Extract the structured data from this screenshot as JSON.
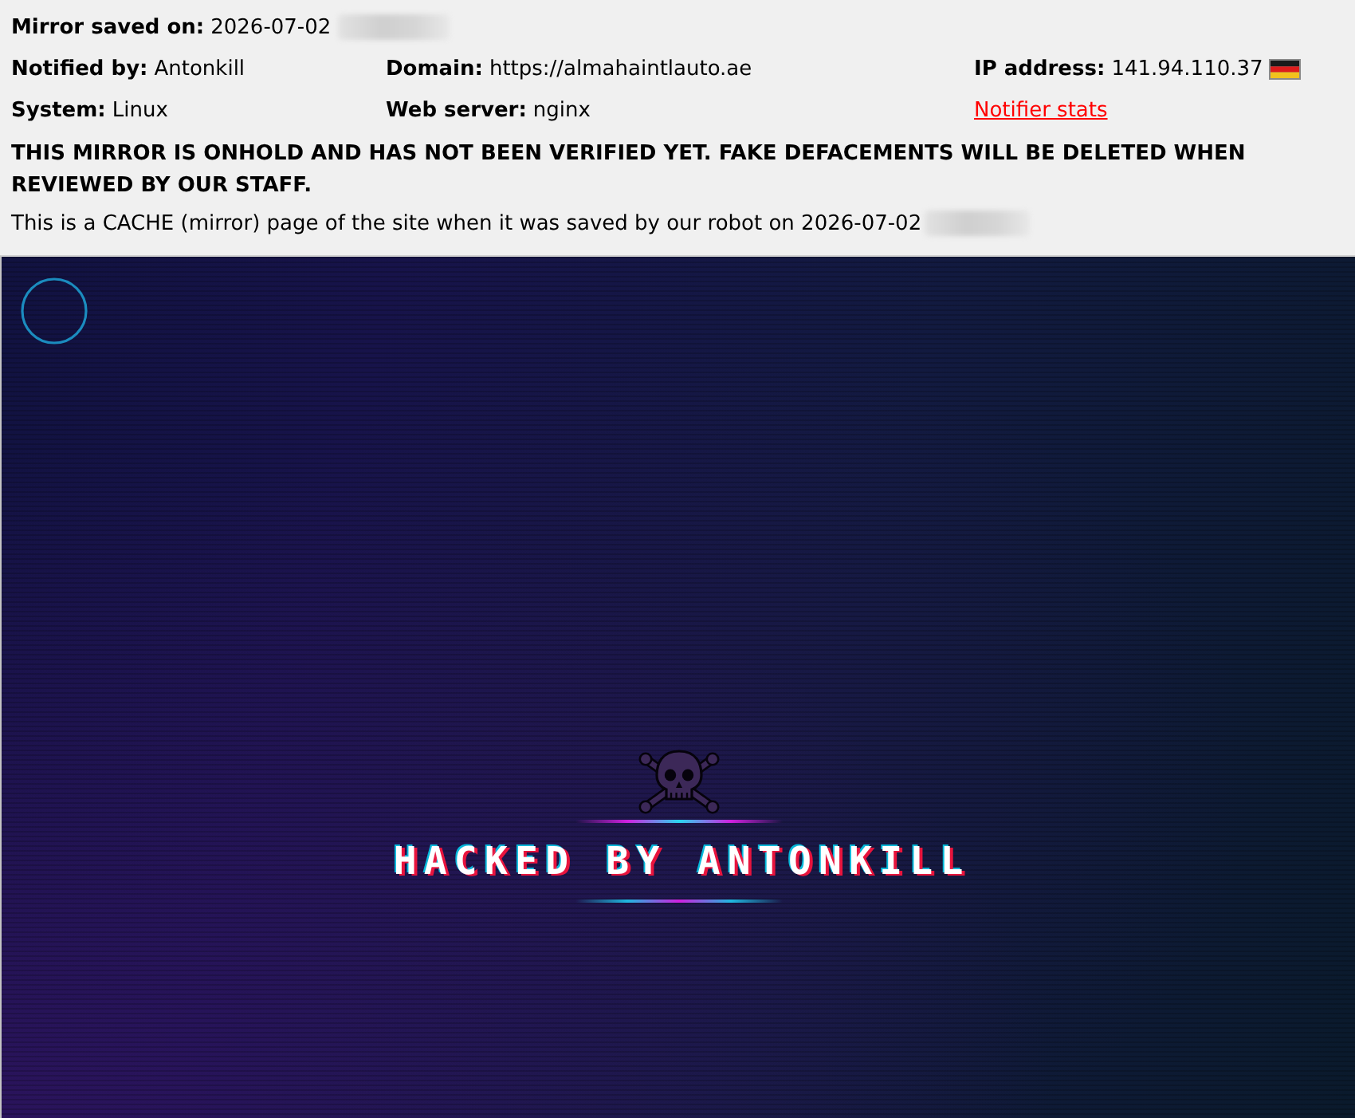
{
  "header": {
    "saved": {
      "label": "Mirror saved on:",
      "value": "2026-07-02",
      "blurred": true
    },
    "fields": [
      {
        "kind": "field",
        "label": "Notified by:",
        "value": "Antonkill"
      },
      {
        "kind": "field",
        "label": "Domain:",
        "value": "https://almahaintlauto.ae"
      },
      {
        "kind": "field_flag",
        "label": "IP address:",
        "value": "141.94.110.37"
      },
      {
        "kind": "field",
        "label": "System:",
        "value": "Linux"
      },
      {
        "kind": "field",
        "label": "Web server:",
        "value": "nginx"
      },
      {
        "kind": "link",
        "value": "Notifier stats"
      }
    ],
    "notice": "THIS MIRROR IS ONHOLD AND HAS NOT BEEN VERIFIED YET. FAKE DEFACEMENTS WILL BE DELETED WHEN REVIEWED BY OUR STAFF.",
    "cache_note": {
      "text": "This is a CACHE (mirror) page of the site when it was saved by our robot on 2026-07-02",
      "blurred": true
    }
  },
  "deface": {
    "title": "HACKED BY ANTONKILL"
  }
}
